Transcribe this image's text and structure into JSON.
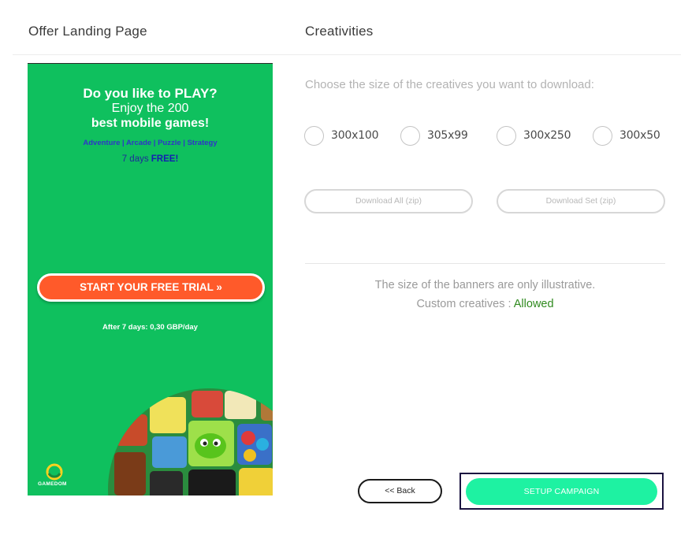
{
  "header": {
    "left_title": "Offer Landing Page",
    "right_title": "Creativities"
  },
  "landing": {
    "line1": "Do you like to PLAY?",
    "line2": "Enjoy the 200",
    "line3": "best mobile games!",
    "categories": "Adventure | Arcade | Puzzle | Strategy",
    "free_prefix": "7 days ",
    "free_bold": "FREE!",
    "cta": "START YOUR FREE TRIAL »",
    "after": "After 7 days: 0,30 GBP/day",
    "brand": "GAMEDOM",
    "colors": {
      "background": "#0fc05e",
      "cta": "#ff5a2a"
    }
  },
  "creatives": {
    "prompt": "Choose the size of the creatives you want to download:",
    "sizes": [
      "300x100",
      "305x99",
      "300x250",
      "300x50"
    ],
    "download_all": "Download All (zip)",
    "download_set": "Download Set (zip)",
    "note": "The size of the banners are only illustrative.",
    "custom_label": "Custom creatives :",
    "custom_value": "Allowed"
  },
  "actions": {
    "back": "<< Back",
    "setup": "SETUP CAMPAIGN",
    "setup_color": "#1ef2a2"
  }
}
